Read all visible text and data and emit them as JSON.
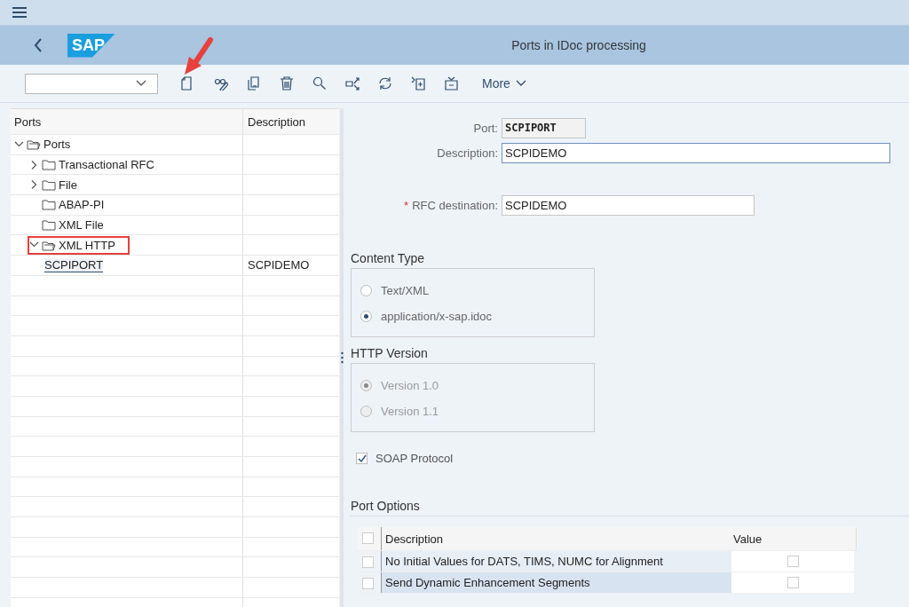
{
  "header": {
    "title": "Ports in IDoc processing",
    "logo": "SAP"
  },
  "toolbar": {
    "more": "More"
  },
  "tree": {
    "columns": [
      "Ports",
      "Description"
    ],
    "items": [
      {
        "label": "Ports",
        "kind": "folder",
        "expandable": true,
        "expanded": true,
        "highlighted": false,
        "selected": false,
        "children": [
          {
            "label": "Transactional RFC",
            "kind": "folder",
            "expandable": true,
            "expanded": false,
            "highlighted": false,
            "selected": false
          },
          {
            "label": "File",
            "kind": "folder",
            "expandable": true,
            "expanded": false,
            "highlighted": false,
            "selected": false
          },
          {
            "label": "ABAP-PI",
            "kind": "folder",
            "expandable": false,
            "expanded": false,
            "highlighted": false,
            "selected": false
          },
          {
            "label": "XML File",
            "kind": "folder",
            "expandable": false,
            "expanded": false,
            "highlighted": false,
            "selected": false
          },
          {
            "label": "XML HTTP",
            "kind": "folder",
            "expandable": true,
            "expanded": true,
            "highlighted": true,
            "selected": false,
            "children": [
              {
                "label": "SCPIPORT",
                "description": "SCPIDEMO",
                "highlighted": false,
                "selected": true
              }
            ]
          }
        ]
      }
    ]
  },
  "form": {
    "fields": [
      {
        "label": "Port:",
        "value": "SCPIPORT",
        "kind": "readonly"
      },
      {
        "label": "Description:",
        "value": "SCPIDEMO",
        "kind": "focused"
      },
      {
        "label": "RFC destination:",
        "value": "SCPIDEMO",
        "kind": "input",
        "required_mark": "*"
      }
    ],
    "groups": [
      {
        "title": "Content Type",
        "disabled": false,
        "options": [
          {
            "label": "Text/XML",
            "selected": false
          },
          {
            "label": "application/x-sap.idoc",
            "selected": true
          }
        ]
      },
      {
        "title": "HTTP Version",
        "disabled": true,
        "options": [
          {
            "label": "Version 1.0",
            "selected": true
          },
          {
            "label": "Version 1.1",
            "selected": false
          }
        ]
      }
    ],
    "soap": {
      "label": "SOAP Protocol",
      "checked": true
    },
    "port_options": {
      "title": "Port Options",
      "all_selected": false,
      "columns": [
        "Description",
        "Value"
      ],
      "rows": [
        {
          "description": "No Initial Values for DATS, TIMS, NUMC for Alignment",
          "value": false,
          "selected": false
        },
        {
          "description": "Send Dynamic Enhancement Segments",
          "value": false,
          "selected": false
        }
      ]
    }
  }
}
